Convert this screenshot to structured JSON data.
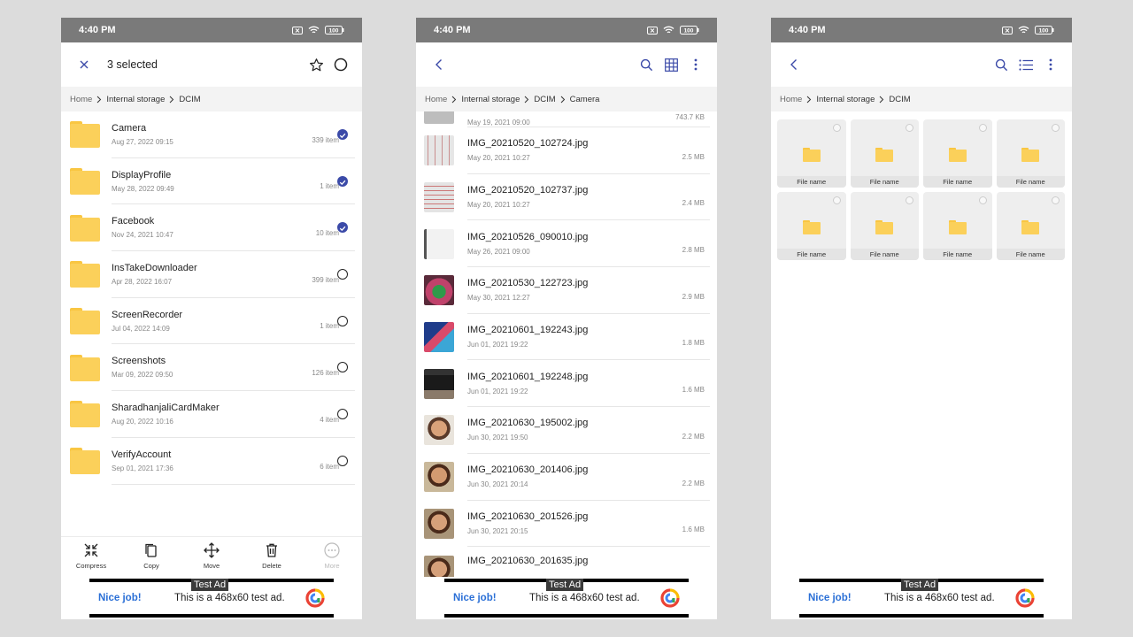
{
  "status": {
    "time": "4:40 PM",
    "battery": "100"
  },
  "phone1": {
    "title": "3 selected",
    "breadcrumb": [
      "Home",
      "Internal storage",
      "DCIM"
    ],
    "folders": [
      {
        "name": "Camera",
        "date": "Aug 27, 2022 09:15",
        "count": "339 item",
        "checked": true
      },
      {
        "name": "DisplayProfile",
        "date": "May 28, 2022 09:49",
        "count": "1 item",
        "checked": true
      },
      {
        "name": "Facebook",
        "date": "Nov 24, 2021 10:47",
        "count": "10 item",
        "checked": true
      },
      {
        "name": "InsTakeDownloader",
        "date": "Apr 28, 2022 16:07",
        "count": "399 item",
        "checked": false
      },
      {
        "name": "ScreenRecorder",
        "date": "Jul 04, 2022 14:09",
        "count": "1 item",
        "checked": false
      },
      {
        "name": "Screenshots",
        "date": "Mar 09, 2022 09:50",
        "count": "126 item",
        "checked": false
      },
      {
        "name": "SharadhanjaliCardMaker",
        "date": "Aug 20, 2022 10:16",
        "count": "4 item",
        "checked": false
      },
      {
        "name": "VerifyAccount",
        "date": "Sep 01, 2021 17:36",
        "count": "6 item",
        "checked": false
      }
    ],
    "actions": [
      {
        "label": "Compress",
        "icon": "compress-icon",
        "disabled": false
      },
      {
        "label": "Copy",
        "icon": "copy-icon",
        "disabled": false
      },
      {
        "label": "Move",
        "icon": "move-icon",
        "disabled": false
      },
      {
        "label": "Delete",
        "icon": "delete-icon",
        "disabled": false
      },
      {
        "label": "More",
        "icon": "more-icon",
        "disabled": true
      }
    ]
  },
  "phone2": {
    "breadcrumb": [
      "Home",
      "Internal storage",
      "DCIM",
      "Camera"
    ],
    "files": [
      {
        "name": "",
        "date": "May 19, 2021 09:00",
        "size": "743.7 KB",
        "thumb": "grey"
      },
      {
        "name": "IMG_20210520_102724.jpg",
        "date": "May 20, 2021 10:27",
        "size": "2.5 MB",
        "thumb": "chart"
      },
      {
        "name": "IMG_20210520_102737.jpg",
        "date": "May 20, 2021 10:27",
        "size": "2.4 MB",
        "thumb": "chart"
      },
      {
        "name": "IMG_20210526_090010.jpg",
        "date": "May 26, 2021 09:00",
        "size": "2.8 MB",
        "thumb": "paper"
      },
      {
        "name": "IMG_20210530_122723.jpg",
        "date": "May 30, 2021 12:27",
        "size": "2.9 MB",
        "thumb": "phone"
      },
      {
        "name": "IMG_20210601_192243.jpg",
        "date": "Jun 01, 2021 19:22",
        "size": "1.8 MB",
        "thumb": "card"
      },
      {
        "name": "IMG_20210601_192248.jpg",
        "date": "Jun 01, 2021 19:22",
        "size": "1.6 MB",
        "thumb": "darkcard"
      },
      {
        "name": "IMG_20210630_195002.jpg",
        "date": "Jun 30, 2021 19:50",
        "size": "2.2 MB",
        "thumb": "child"
      },
      {
        "name": "IMG_20210630_201406.jpg",
        "date": "Jun 30, 2021 20:14",
        "size": "2.2 MB",
        "thumb": "child"
      },
      {
        "name": "IMG_20210630_201526.jpg",
        "date": "Jun 30, 2021 20:15",
        "size": "1.6 MB",
        "thumb": "child"
      },
      {
        "name": "IMG_20210630_201635.jpg",
        "date": "",
        "size": "",
        "thumb": "child"
      }
    ]
  },
  "phone3": {
    "breadcrumb": [
      "Home",
      "Internal storage",
      "DCIM"
    ],
    "tiles": [
      "File name",
      "File name",
      "File name",
      "File name",
      "File name",
      "File name",
      "File name",
      "File name"
    ]
  },
  "ad": {
    "label": "Test Ad",
    "nice": "Nice job!",
    "message": "This is a 468x60 test ad."
  },
  "colors": {
    "accent": "#3b4aa8",
    "folder": "#fbd05a",
    "statusbar": "#7a7a7a",
    "adlink": "#2a6fd6"
  }
}
